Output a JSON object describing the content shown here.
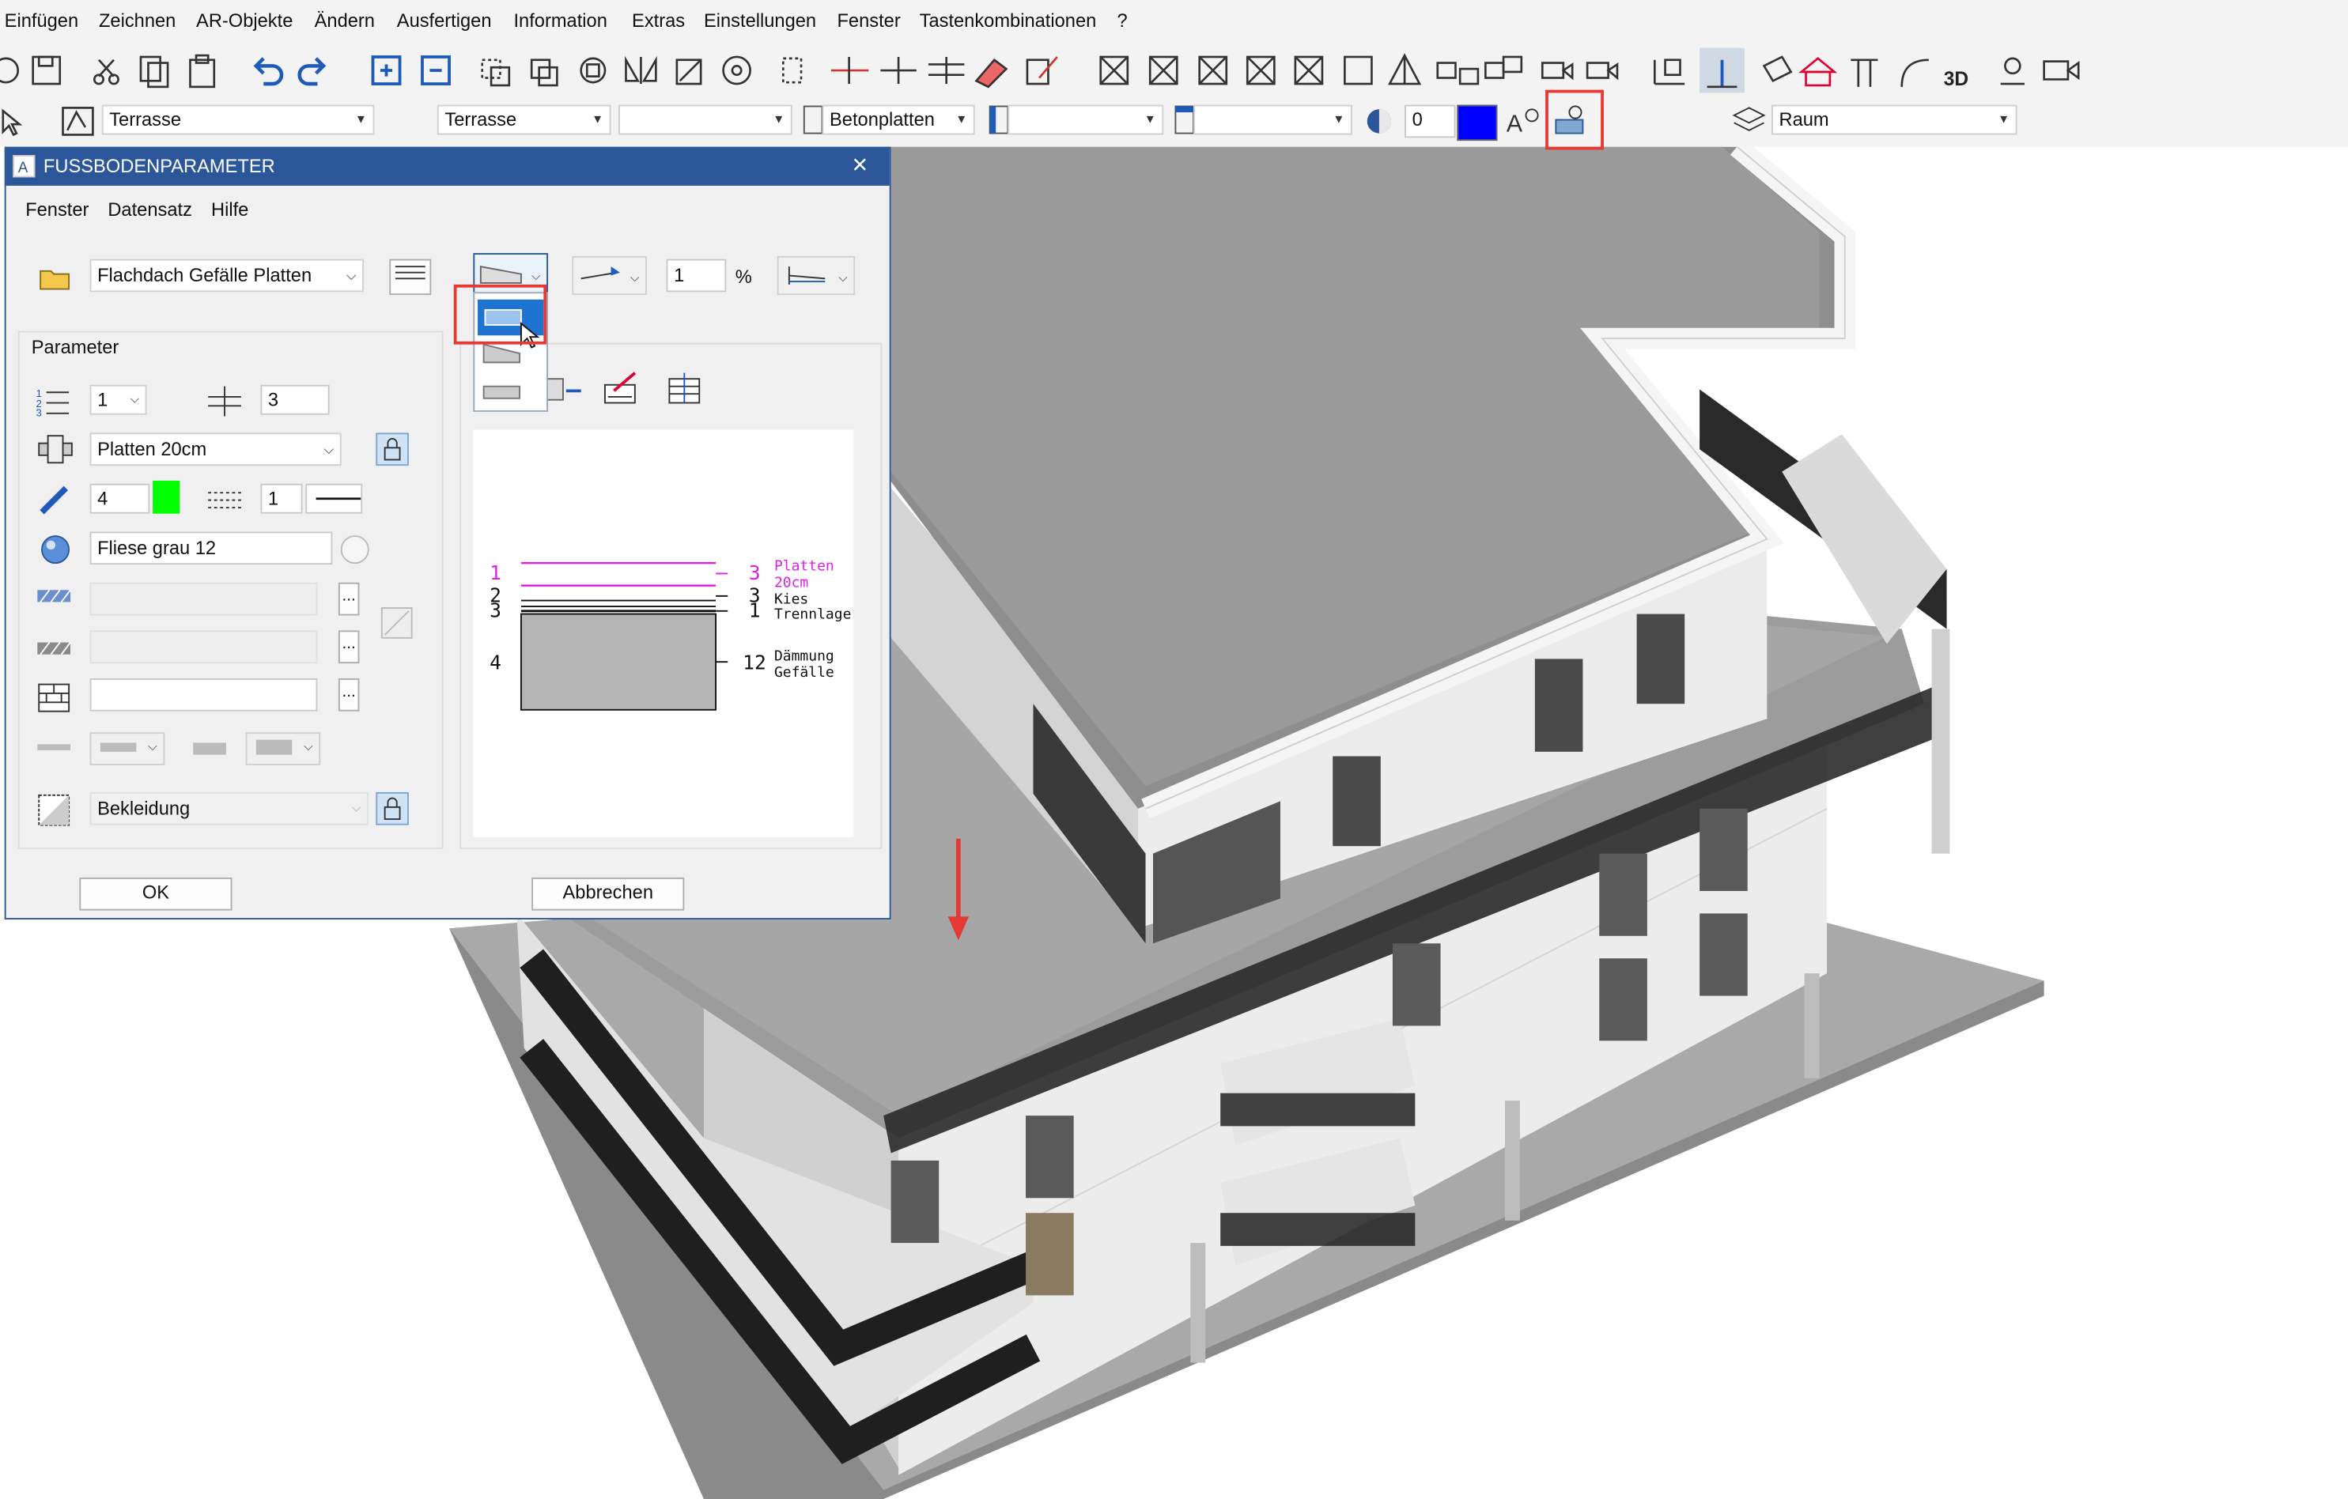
{
  "menubar": {
    "items": [
      "Einfügen",
      "Zeichnen",
      "AR-Objekte",
      "Ändern",
      "Ausfertigen",
      "Information",
      "Extras",
      "Einstellungen",
      "Fenster",
      "Tastenkombinationen",
      "?"
    ]
  },
  "toolbar2": {
    "layer_combo": "Terrasse",
    "style_combo": "Terrasse",
    "empty_combo": "",
    "material_combo": "Betonplatten",
    "pen_value": "0",
    "pen_color": "#0000ff",
    "room_combo": "Raum"
  },
  "dialog": {
    "title": "FUSSBODENPARAMETER",
    "close_glyph": "×",
    "menus": [
      "Fenster",
      "Datensatz",
      "Hilfe"
    ],
    "favorite": "Flachdach Gefälle Platten",
    "slope_value": "1",
    "slope_unit": "%",
    "param_heading": "Parameter",
    "layer_index": "1",
    "layer_count": "3",
    "material": "Platten 20cm",
    "pen": "4",
    "pen_color": "#00ff00",
    "line": "1",
    "surface": "Fliese grau 12",
    "hatch1": "",
    "hatch2": "",
    "pattern": "",
    "ellipsis": "...",
    "finish": "Bekleidung",
    "ok_label": "OK",
    "cancel_label": "Abbrechen",
    "preview": {
      "left_numbers": [
        "1",
        "2",
        "3",
        "4"
      ],
      "right_numbers": [
        "3",
        "3",
        "1",
        "12"
      ],
      "layer_labels": [
        "Platten",
        "20cm",
        "Kies",
        "Trennlage",
        "Dämmung",
        "Gefälle"
      ]
    }
  },
  "colors": {
    "accent": "#2b579a",
    "highlight": "#e53935",
    "preview_magenta": "#e020e0"
  }
}
